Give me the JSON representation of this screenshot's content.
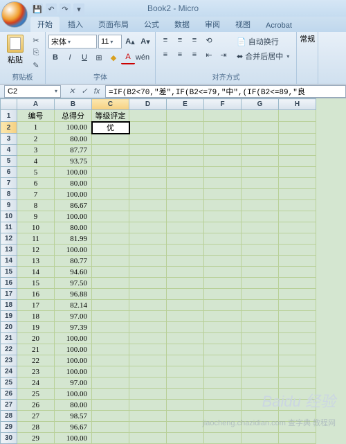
{
  "title": "Book2 - Micro",
  "qat": {
    "save": "💾",
    "undo": "↶",
    "redo": "↷",
    "down": "▾"
  },
  "tabs": [
    "开始",
    "插入",
    "页面布局",
    "公式",
    "数据",
    "审阅",
    "视图",
    "Acrobat"
  ],
  "activeTab": 0,
  "ribbon": {
    "clipboard": {
      "label": "剪贴板",
      "paste": "粘贴",
      "cut": "✂",
      "copy": "⎘",
      "brush": "✎"
    },
    "font": {
      "label": "字体",
      "name": "宋体",
      "size": "11",
      "bold": "B",
      "italic": "I",
      "underline": "U",
      "border": "⊞",
      "fill": "🪣",
      "color": "A",
      "grow": "A↑",
      "shrink": "A↓",
      "aa": "A"
    },
    "align": {
      "label": "对齐方式",
      "wrap": "自动换行",
      "merge": "合并后居中"
    },
    "number": {
      "label": "常规"
    }
  },
  "namebox": "C2",
  "formula": "=IF(B2<70,\"差\",IF(B2<=79,\"中\",(IF(B2<=89,\"良",
  "columns": [
    "A",
    "B",
    "C",
    "D",
    "E",
    "F",
    "G",
    "H"
  ],
  "headers": {
    "A": "编号",
    "B": "总得分",
    "C": "等级评定"
  },
  "activeCell": {
    "row": 2,
    "col": "C",
    "value": "优"
  },
  "rows": [
    {
      "n": 1,
      "a": "1",
      "b": "100.00"
    },
    {
      "n": 2,
      "a": "2",
      "b": "80.00"
    },
    {
      "n": 3,
      "a": "3",
      "b": "87.77"
    },
    {
      "n": 4,
      "a": "4",
      "b": "93.75"
    },
    {
      "n": 5,
      "a": "5",
      "b": "100.00"
    },
    {
      "n": 6,
      "a": "6",
      "b": "80.00"
    },
    {
      "n": 7,
      "a": "7",
      "b": "100.00"
    },
    {
      "n": 8,
      "a": "8",
      "b": "86.67"
    },
    {
      "n": 9,
      "a": "9",
      "b": "100.00"
    },
    {
      "n": 10,
      "a": "10",
      "b": "80.00"
    },
    {
      "n": 11,
      "a": "11",
      "b": "81.99"
    },
    {
      "n": 12,
      "a": "12",
      "b": "100.00"
    },
    {
      "n": 13,
      "a": "13",
      "b": "80.77"
    },
    {
      "n": 14,
      "a": "14",
      "b": "94.60"
    },
    {
      "n": 15,
      "a": "15",
      "b": "97.50"
    },
    {
      "n": 16,
      "a": "16",
      "b": "96.88"
    },
    {
      "n": 17,
      "a": "17",
      "b": "82.14"
    },
    {
      "n": 18,
      "a": "18",
      "b": "97.00"
    },
    {
      "n": 19,
      "a": "19",
      "b": "97.39"
    },
    {
      "n": 20,
      "a": "20",
      "b": "100.00"
    },
    {
      "n": 21,
      "a": "21",
      "b": "100.00"
    },
    {
      "n": 22,
      "a": "22",
      "b": "100.00"
    },
    {
      "n": 23,
      "a": "23",
      "b": "100.00"
    },
    {
      "n": 24,
      "a": "24",
      "b": "97.00"
    },
    {
      "n": 25,
      "a": "25",
      "b": "100.00"
    },
    {
      "n": 26,
      "a": "26",
      "b": "80.00"
    },
    {
      "n": 27,
      "a": "27",
      "b": "98.57"
    },
    {
      "n": 28,
      "a": "28",
      "b": "96.67"
    },
    {
      "n": 29,
      "a": "29",
      "b": "100.00"
    }
  ],
  "watermark": "Baidu 经验",
  "watermark2": "jiaocheng.chazidian.com 查字典 教程网"
}
